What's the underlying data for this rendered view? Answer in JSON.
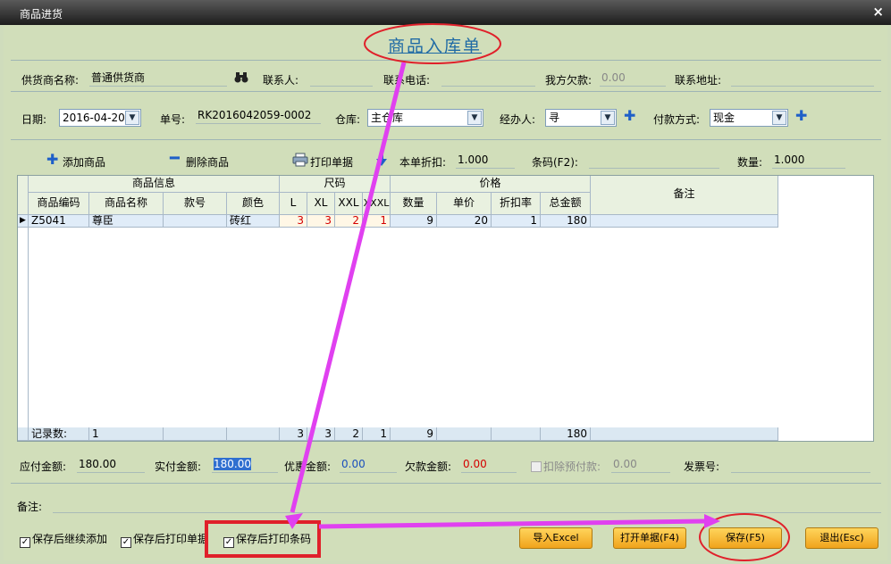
{
  "window": {
    "title": "商品进货",
    "close_glyph": "×"
  },
  "form": {
    "heading": "商品入库单",
    "row1": {
      "supplier_label": "供货商名称:",
      "supplier_value": "普通供货商",
      "contact_label": "联系人:",
      "phone_label": "联系电话:",
      "debt_label": "我方欠款:",
      "debt_value": "0.00",
      "address_label": "联系地址:"
    },
    "row2": {
      "date_label": "日期:",
      "date_value": "2016-04-20",
      "order_label": "单号:",
      "order_value": "RK2016042059-0002",
      "warehouse_label": "仓库:",
      "warehouse_value": "主仓库",
      "handler_label": "经办人:",
      "handler_value": "寻",
      "payment_label": "付款方式:",
      "payment_value": "现金"
    },
    "toolbar": {
      "add_label": "添加商品",
      "delete_label": "删除商品",
      "print_label": "打印单据",
      "discount_label": "本单折扣:",
      "discount_value": "1.000",
      "barcode_label": "条码(F2):",
      "qty_label": "数量:",
      "qty_value": "1.000"
    }
  },
  "table": {
    "groups": [
      "商品信息",
      "尺码",
      "价格",
      "备注"
    ],
    "columns": [
      "商品编码",
      "商品名称",
      "款号",
      "颜色",
      "L",
      "XL",
      "XXL",
      "XXXL",
      "数量",
      "单价",
      "折扣率",
      "总金额"
    ],
    "rows": [
      [
        "Z5041",
        "尊臣",
        "",
        "砖红",
        "3",
        "3",
        "2",
        "1",
        "9",
        "20",
        "1",
        "180",
        ""
      ]
    ],
    "footer": {
      "label": "记录数:",
      "count": "1",
      "l": "3",
      "xl": "3",
      "xxl": "2",
      "xxxl": "1",
      "qty": "9",
      "total": "180"
    }
  },
  "totals": {
    "payable_label": "应付金额:",
    "payable_value": "180.00",
    "paid_label": "实付金额:",
    "paid_value": "180.00",
    "discount_label": "优惠金额:",
    "discount_value": "0.00",
    "owed_label": "欠款金额:",
    "owed_value": "0.00",
    "deduct_label": "扣除预付款:",
    "deduct_value": "0.00",
    "invoice_label": "发票号:"
  },
  "remark_label": "备注:",
  "options": {
    "continue_add": "保存后继续添加",
    "print_doc": "保存后打印单据",
    "print_barcode": "保存后打印条码",
    "check_glyph": "✓"
  },
  "buttons": {
    "import_excel": "导入Excel",
    "open_doc": "打开单据(F4)",
    "save": "保存(F5)",
    "exit": "退出(Esc)"
  },
  "icons": {
    "binoculars": "binoculars-icon",
    "plus": "plus-icon",
    "minus": "minus-icon",
    "printer": "printer-icon",
    "down_arrow": "down-arrow-icon",
    "row_pointer": "row-pointer-icon"
  },
  "colors": {
    "annotation_magenta": "#e040f0",
    "annotation_red": "#e0202a",
    "accent_blue": "#1f6aa5"
  }
}
